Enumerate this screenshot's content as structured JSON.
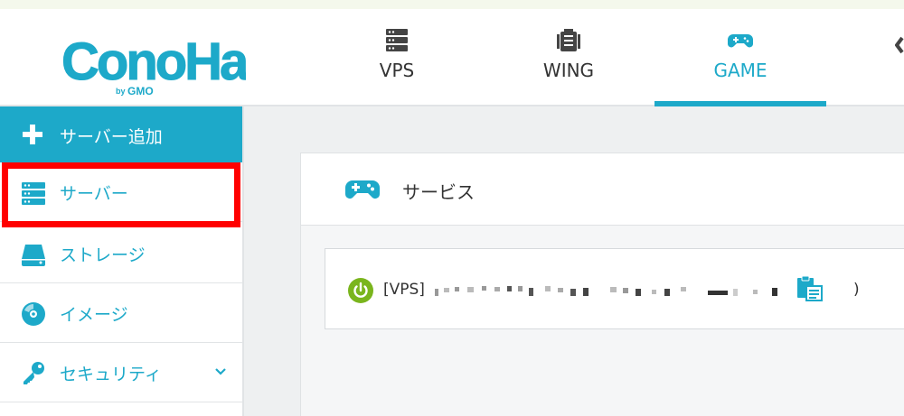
{
  "colors": {
    "brand": "#1da9c9",
    "highlight": "#ff0000",
    "power_green": "#7ab51d"
  },
  "header": {
    "logo_alt": "ConoHa by GMO",
    "tabs": [
      {
        "label": "VPS",
        "icon": "server-rack-icon",
        "active": false
      },
      {
        "label": "WING",
        "icon": "server-stack-icon",
        "active": false
      },
      {
        "label": "GAME",
        "icon": "gamepad-icon",
        "active": true
      }
    ]
  },
  "sidebar": {
    "add_button": {
      "label": "サーバー追加",
      "icon": "plus-icon"
    },
    "items": [
      {
        "label": "サーバー",
        "icon": "server-icon"
      },
      {
        "label": "ストレージ",
        "icon": "storage-icon"
      },
      {
        "label": "イメージ",
        "icon": "disc-icon"
      },
      {
        "label": "セキュリティ",
        "icon": "key-icon",
        "expandable": true
      }
    ]
  },
  "main": {
    "panel_title": "サービス",
    "service": {
      "prefix": "[VPS]",
      "suffix": ")",
      "status_icon": "power-icon",
      "copy_icon": "clipboard-icon"
    }
  }
}
